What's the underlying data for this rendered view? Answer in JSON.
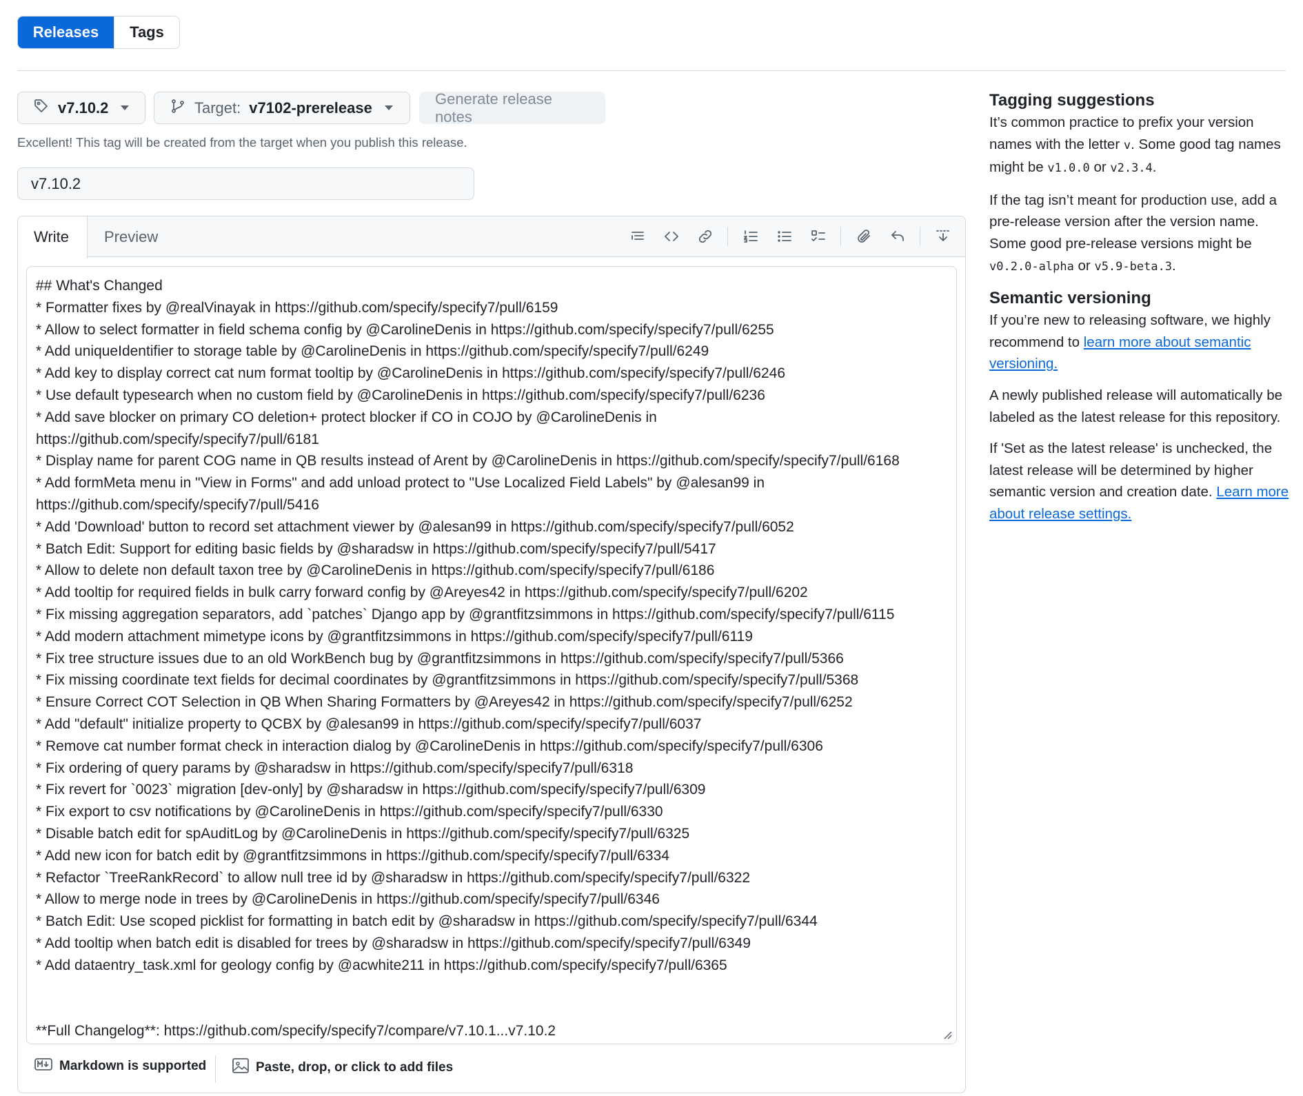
{
  "tabs": {
    "releases": "Releases",
    "tags": "Tags"
  },
  "tag_button": {
    "label": "v7.10.2"
  },
  "target_button": {
    "prefix": "Target:",
    "value": "v7102-prerelease"
  },
  "generate_button": {
    "label": "Generate release notes"
  },
  "tag_hint": "Excellent! This tag will be created from the target when you publish this release.",
  "release_title": {
    "value": "v7.10.2"
  },
  "editor": {
    "tabs": {
      "write": "Write",
      "preview": "Preview"
    },
    "toolbar_icons": [
      "heading-icon",
      "code-icon",
      "link-icon",
      "ordered-list-icon",
      "unordered-list-icon",
      "task-list-icon",
      "attach-icon",
      "undo-icon",
      "collapse-toolbar-icon"
    ],
    "body_lines": [
      "## What's Changed",
      "* Formatter fixes by @realVinayak in https://github.com/specify/specify7/pull/6159",
      "* Allow to select formatter in field schema config by @CarolineDenis in https://github.com/specify/specify7/pull/6255",
      "* Add uniqueIdentifier to storage table by @CarolineDenis in https://github.com/specify/specify7/pull/6249",
      "* Add key to display correct cat num format tooltip by @CarolineDenis in https://github.com/specify/specify7/pull/6246",
      "* Use default typesearch when no custom field by @CarolineDenis in https://github.com/specify/specify7/pull/6236",
      "* Add save blocker on primary CO deletion+ protect blocker if CO in COJO by @CarolineDenis in",
      "https://github.com/specify/specify7/pull/6181",
      "* Display name for parent COG name in QB results instead of Arent by @CarolineDenis in https://github.com/specify/specify7/pull/6168",
      "* Add formMeta menu in \"View in Forms\" and add unload protect to \"Use Localized Field Labels\" by @alesan99 in",
      "https://github.com/specify/specify7/pull/5416",
      "* Add 'Download' button to record set attachment viewer by @alesan99 in https://github.com/specify/specify7/pull/6052",
      "* Batch Edit: Support for editing basic fields by @sharadsw in https://github.com/specify/specify7/pull/5417",
      "* Allow to delete non default taxon tree by @CarolineDenis in https://github.com/specify/specify7/pull/6186",
      "* Add tooltip for required fields in bulk carry forward config by @Areyes42 in https://github.com/specify/specify7/pull/6202",
      "* Fix missing aggregation separators, add `patches` Django app by @grantfitzsimmons in https://github.com/specify/specify7/pull/6115",
      "* Add modern attachment mimetype icons by @grantfitzsimmons in https://github.com/specify/specify7/pull/6119",
      "* Fix tree structure issues due to an old WorkBench bug by @grantfitzsimmons in https://github.com/specify/specify7/pull/5366",
      "* Fix missing coordinate text fields for decimal coordinates by @grantfitzsimmons in https://github.com/specify/specify7/pull/5368",
      "* Ensure Correct COT Selection in QB When Sharing Formatters by @Areyes42 in https://github.com/specify/specify7/pull/6252",
      "* Add \"default\" initialize property to QCBX by @alesan99 in https://github.com/specify/specify7/pull/6037",
      "* Remove cat number format check in interaction dialog by @CarolineDenis in https://github.com/specify/specify7/pull/6306",
      "* Fix ordering of query params by @sharadsw in https://github.com/specify/specify7/pull/6318",
      "* Fix revert for `0023` migration [dev-only] by @sharadsw in https://github.com/specify/specify7/pull/6309",
      "* Fix export to csv notifications by @CarolineDenis in https://github.com/specify/specify7/pull/6330",
      "* Disable batch edit for spAuditLog by @CarolineDenis in https://github.com/specify/specify7/pull/6325",
      "* Add new icon for batch edit by @grantfitzsimmons in https://github.com/specify/specify7/pull/6334",
      "* Refactor `TreeRankRecord` to allow null tree id by @sharadsw in https://github.com/specify/specify7/pull/6322",
      "* Allow to merge node in trees by @CarolineDenis in https://github.com/specify/specify7/pull/6346",
      "* Batch Edit: Use scoped picklist for formatting in batch edit by @sharadsw in https://github.com/specify/specify7/pull/6344",
      "* Add tooltip when batch edit is disabled for trees by @sharadsw in https://github.com/specify/specify7/pull/6349",
      "* Add dataentry_task.xml for geology config by @acwhite211 in https://github.com/specify/specify7/pull/6365",
      "",
      "",
      "**Full Changelog**: https://github.com/specify/specify7/compare/v7.10.1...v7.10.2"
    ],
    "footer": {
      "markdown": "Markdown is supported",
      "attach": "Paste, drop, or click to add files"
    }
  },
  "sidebar": {
    "tagging_title": "Tagging suggestions",
    "tagging_p1": [
      "It’s common practice to prefix your version names with the letter ",
      "v",
      ". Some good tag names might be ",
      "v1.0.0",
      " or ",
      "v2.3.4",
      "."
    ],
    "tagging_p2": [
      "If the tag isn’t meant for production use, add a pre-release version after the version name. Some good pre-release versions might be ",
      "v0.2.0-alpha",
      " or ",
      "v5.9-beta.3",
      "."
    ],
    "semver_title": "Semantic versioning",
    "semver_p1_text": "If you’re new to releasing software, we highly recommend to ",
    "semver_p1_link": "learn more about semantic versioning.",
    "semver_p2": "A newly published release will automatically be labeled as the latest release for this repository.",
    "semver_p3_text": "If 'Set as the latest release' is unchecked, the latest release will be determined by higher semantic version and creation date. ",
    "semver_p3_link": "Learn more about release settings."
  }
}
